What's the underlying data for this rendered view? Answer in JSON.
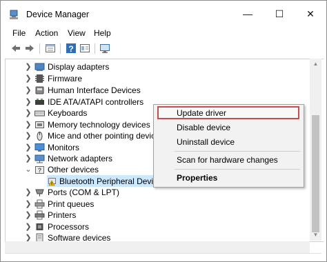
{
  "window": {
    "title": "Device Manager",
    "minimize_glyph": "—",
    "maximize_glyph": "☐",
    "close_glyph": "✕"
  },
  "menu": [
    "File",
    "Action",
    "View",
    "Help"
  ],
  "toolbar": {
    "icons": [
      "back-arrow-icon",
      "forward-arrow-icon",
      "properties-icon",
      "help-icon",
      "view-icon",
      "monitor-scan-icon"
    ]
  },
  "tree": [
    {
      "label": "Display adapters",
      "expanded": false,
      "icon": "display-adapter-icon"
    },
    {
      "label": "Firmware",
      "expanded": false,
      "icon": "firmware-icon"
    },
    {
      "label": "Human Interface Devices",
      "expanded": false,
      "icon": "hid-icon"
    },
    {
      "label": "IDE ATA/ATAPI controllers",
      "expanded": false,
      "icon": "ide-controller-icon"
    },
    {
      "label": "Keyboards",
      "expanded": false,
      "icon": "keyboard-icon"
    },
    {
      "label": "Memory technology devices",
      "expanded": false,
      "icon": "memory-device-icon"
    },
    {
      "label": "Mice and other pointing devices",
      "expanded": false,
      "icon": "mouse-icon"
    },
    {
      "label": "Monitors",
      "expanded": false,
      "icon": "monitor-icon"
    },
    {
      "label": "Network adapters",
      "expanded": false,
      "icon": "network-adapter-icon"
    },
    {
      "label": "Other devices",
      "expanded": true,
      "icon": "other-devices-icon"
    },
    {
      "label": "Bluetooth Peripheral Device",
      "child": true,
      "selected": true,
      "icon": "unknown-device-warning-icon"
    },
    {
      "label": "Ports (COM & LPT)",
      "expanded": false,
      "icon": "port-icon"
    },
    {
      "label": "Print queues",
      "expanded": false,
      "icon": "print-queue-icon"
    },
    {
      "label": "Printers",
      "expanded": false,
      "icon": "printer-icon"
    },
    {
      "label": "Processors",
      "expanded": false,
      "icon": "processor-icon"
    },
    {
      "label": "Software devices",
      "expanded": false,
      "icon": "software-device-icon"
    }
  ],
  "context_menu": {
    "items": [
      {
        "label": "Update driver",
        "highlighted": true
      },
      {
        "label": "Disable device"
      },
      {
        "label": "Uninstall device"
      },
      {
        "label": "Scan for hardware changes"
      },
      {
        "label": "Properties",
        "bold": true
      }
    ]
  },
  "colors": {
    "selection": "#cce8ff",
    "highlight_outline": "#c0504d",
    "context_background": "#f2f2f2"
  }
}
